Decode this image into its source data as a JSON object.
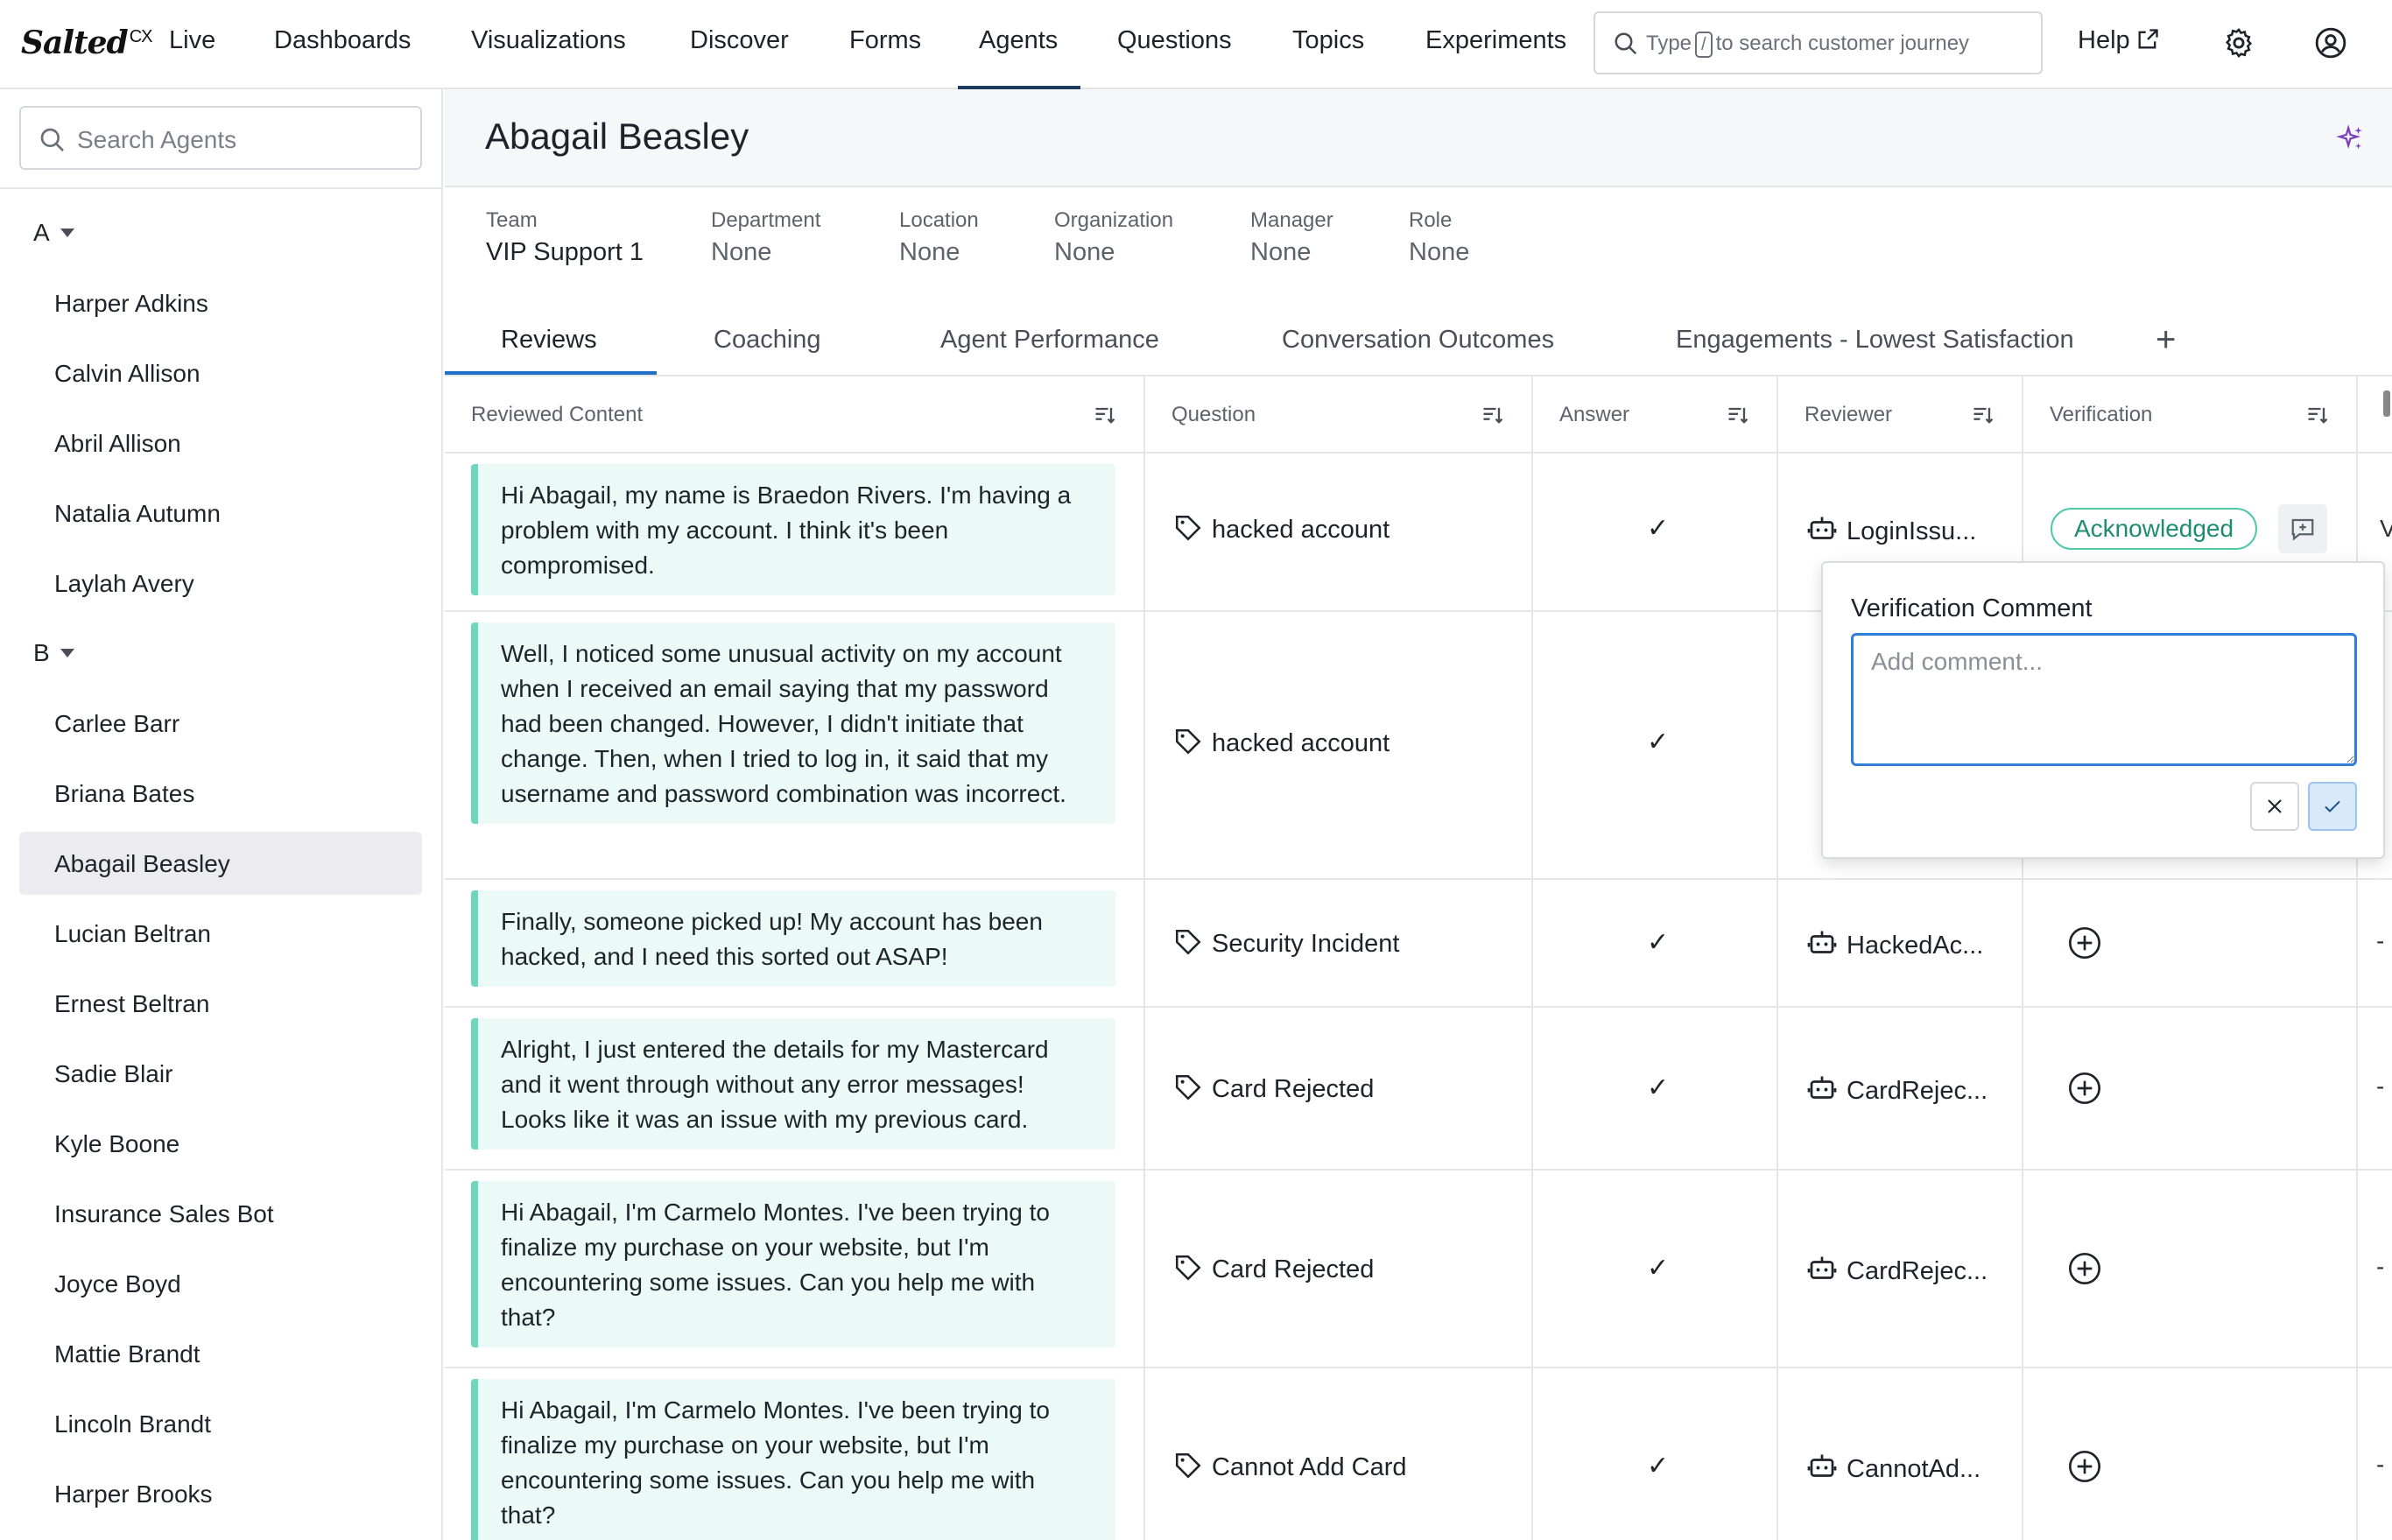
{
  "app": {
    "logo_text": "Salted",
    "logo_sup": "CX"
  },
  "nav": {
    "items": [
      {
        "label": "Live"
      },
      {
        "label": "Dashboards"
      },
      {
        "label": "Visualizations"
      },
      {
        "label": "Discover"
      },
      {
        "label": "Forms"
      },
      {
        "label": "Agents",
        "active": true
      },
      {
        "label": "Questions"
      },
      {
        "label": "Topics"
      },
      {
        "label": "Experiments"
      }
    ],
    "search": {
      "prefix": "Type",
      "key": "/",
      "suffix": "to search customer journey"
    },
    "help_label": "Help",
    "icons": [
      "external-link-icon",
      "gear-icon",
      "user-circle-icon"
    ]
  },
  "sidebar": {
    "search_placeholder": "Search Agents",
    "groups": [
      {
        "letter": "A",
        "agents": [
          "Harper Adkins",
          "Calvin Allison",
          "Abril Allison",
          "Natalia Autumn",
          "Laylah Avery"
        ]
      },
      {
        "letter": "B",
        "agents": [
          "Carlee Barr",
          "Briana Bates",
          "Abagail Beasley",
          "Lucian Beltran",
          "Ernest Beltran",
          "Sadie Blair",
          "Kyle Boone",
          "Insurance Sales Bot",
          "Joyce Boyd",
          "Mattie Brandt",
          "Lincoln Brandt",
          "Harper Brooks"
        ]
      }
    ],
    "selected": "Abagail Beasley"
  },
  "agent": {
    "name": "Abagail Beasley",
    "meta": [
      {
        "label": "Team",
        "value": "VIP Support 1"
      },
      {
        "label": "Department",
        "value": "None"
      },
      {
        "label": "Location",
        "value": "None"
      },
      {
        "label": "Organization",
        "value": "None"
      },
      {
        "label": "Manager",
        "value": "None"
      },
      {
        "label": "Role",
        "value": "None"
      }
    ]
  },
  "tabs": [
    {
      "label": "Reviews",
      "active": true
    },
    {
      "label": "Coaching"
    },
    {
      "label": "Agent Performance"
    },
    {
      "label": "Conversation Outcomes"
    },
    {
      "label": "Engagements - Lowest Satisfaction"
    }
  ],
  "table": {
    "columns": [
      "Reviewed Content",
      "Question",
      "Answer",
      "Reviewer",
      "Verification"
    ],
    "rows": [
      {
        "content": "Hi Abagail, my name is Braedon Rivers. I'm having a problem with my account. I think it's been compromised.",
        "question": "hacked account",
        "answer": "✓",
        "reviewer": "LoginIssu...",
        "verification": "Acknowledged"
      },
      {
        "content": "Well, I noticed some unusual activity on my account when I received an email saying that my password had been changed. However, I didn't initiate that change. Then, when I tried to log in, it said that my username and password combination was incorrect.",
        "question": "hacked account",
        "answer": "✓",
        "reviewer": "",
        "verification": ""
      },
      {
        "content": "Finally, someone picked up! My account has been hacked, and I need this sorted out ASAP!",
        "question": "Security Incident",
        "answer": "✓",
        "reviewer": "HackedAc...",
        "verification": ""
      },
      {
        "content": "Alright, I just entered the details for my Mastercard and it went through without any error messages! Looks like it was an issue with my previous card.",
        "question": "Card Rejected",
        "answer": "✓",
        "reviewer": "CardRejec...",
        "verification": ""
      },
      {
        "content": "Hi Abagail, I'm Carmelo Montes. I've been trying to finalize my purchase on your website, but I'm encountering some issues. Can you help me with that?",
        "question": "Card Rejected",
        "answer": "✓",
        "reviewer": "CardRejec...",
        "verification": ""
      },
      {
        "content": "Hi Abagail, I'm Carmelo Montes. I've been trying to finalize my purchase on your website, but I'm encountering some issues. Can you help me with that?",
        "question": "Cannot Add Card",
        "answer": "✓",
        "reviewer": "CannotAd...",
        "verification": ""
      }
    ],
    "edge_glyphs": {
      "row0": "V",
      "rest": "-"
    }
  },
  "popover": {
    "title": "Verification Comment",
    "placeholder": "Add comment..."
  },
  "colors": {
    "accent": "#1f6fc4",
    "bubble_bg": "#ebfaf6",
    "bubble_border": "#6fd6be",
    "ack_border": "#4fc9a8",
    "ack_text": "#1d8c70"
  }
}
